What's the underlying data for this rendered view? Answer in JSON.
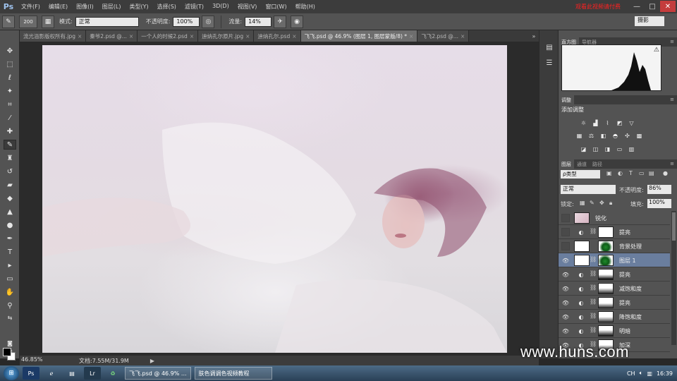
{
  "app": {
    "logo": "Ps",
    "menus": [
      "文件(F)",
      "编辑(E)",
      "图像(I)",
      "图层(L)",
      "类型(Y)",
      "选择(S)",
      "滤镜(T)",
      "3D(D)",
      "视图(V)",
      "窗口(W)",
      "帮助(H)"
    ],
    "window_controls": [
      "—",
      "□",
      "✕"
    ],
    "red_note": "观看此视频请付费 "
  },
  "options": {
    "brush_size": "200",
    "mode_label": "模式:",
    "mode_value": "正常",
    "opacity_label": "不透明度:",
    "opacity_value": "100%",
    "flow_label": "流量:",
    "flow_value": "14%",
    "workspace": "摄影"
  },
  "tabs": [
    {
      "label": "流光溢影版权所有.jpg",
      "active": false
    },
    {
      "label": "秦爷2.psd @...",
      "active": false
    },
    {
      "label": "一个人的时候2.psd",
      "active": false
    },
    {
      "label": "迪纳孔尔原片.jpg",
      "active": false
    },
    {
      "label": "迪纳孔尔.psd",
      "active": false
    },
    {
      "label": "飞飞.psd @ 46.9% (图层 1, 图层蒙版/8) *",
      "active": true
    },
    {
      "label": "飞飞2.psd @...",
      "active": false
    }
  ],
  "status": {
    "zoom": "46.85%",
    "doc_size": "文档:7.55M/31.9M"
  },
  "panels": {
    "histogram_tabs": [
      "直方图",
      "导航器"
    ],
    "adjust_tab": "调整",
    "adjust_title": "添加调整",
    "layer_tabs": [
      "图层",
      "通道",
      "路径"
    ],
    "filter_kind": "ρ类型",
    "blend_mode": "正常",
    "opacity_label": "不透明度:",
    "opacity_value": "86%",
    "lock_label": "锁定:",
    "fill_label": "填充:",
    "fill_value": "100%",
    "layers": [
      {
        "name": "锐化",
        "visible": false,
        "selected": false,
        "thumb": "photo"
      },
      {
        "name": "提亮",
        "visible": false,
        "selected": false,
        "thumb": "white"
      },
      {
        "name": "背景处理",
        "visible": false,
        "selected": false,
        "thumb": "white-green"
      },
      {
        "name": "图层 1",
        "visible": true,
        "selected": true,
        "thumb": "white-green"
      },
      {
        "name": "提亮",
        "visible": true,
        "selected": false,
        "thumb": "mask"
      },
      {
        "name": "减饱和度",
        "visible": true,
        "selected": false,
        "thumb": "mask"
      },
      {
        "name": "提亮",
        "visible": true,
        "selected": false,
        "thumb": "mask"
      },
      {
        "name": "降饱和度",
        "visible": true,
        "selected": false,
        "thumb": "mask"
      },
      {
        "name": "明暗",
        "visible": true,
        "selected": false,
        "thumb": "mask"
      },
      {
        "name": "加深",
        "visible": true,
        "selected": false,
        "thumb": "mask"
      }
    ]
  },
  "watermark": "www.huns.com",
  "taskbar": {
    "tasks": [
      "飞飞.psd @ 46.9% ...",
      "肤色调调色视频教程"
    ],
    "tray_lang": "CH",
    "clock": "16:39"
  },
  "colors": {
    "accent_selected_layer": "#6a7e9e",
    "close_button": "#c43c3c",
    "red_note": "#ff2020"
  }
}
